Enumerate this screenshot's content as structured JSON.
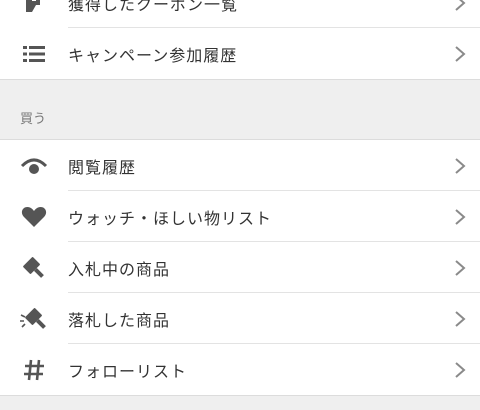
{
  "top_group": {
    "items": [
      {
        "label": "獲得したクーポン一覧",
        "icon": "coupon-icon"
      },
      {
        "label": "キャンペーン参加履歴",
        "icon": "list-icon"
      }
    ]
  },
  "buy_section": {
    "header": "買う",
    "items": [
      {
        "label": "閲覧履歴",
        "icon": "eye-icon"
      },
      {
        "label": "ウォッチ・ほしい物リスト",
        "icon": "heart-icon"
      },
      {
        "label": "入札中の商品",
        "icon": "gavel-icon"
      },
      {
        "label": "落札した商品",
        "icon": "gavel-win-icon"
      },
      {
        "label": "フォローリスト",
        "icon": "hash-icon"
      }
    ]
  },
  "colors": {
    "icon": "#555555",
    "chevron": "#8a8a8a",
    "background": "#efefef",
    "divider": "#e3e3e3"
  }
}
